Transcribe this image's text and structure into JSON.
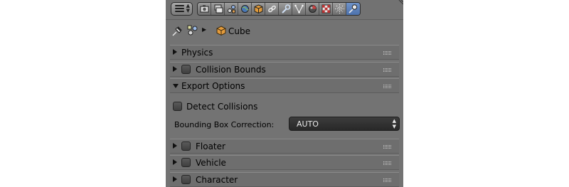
{
  "header": {
    "editor_type_icon": "properties-editor-icon",
    "tabs": [
      {
        "icon": "render-icon"
      },
      {
        "icon": "render-layers-icon"
      },
      {
        "icon": "scene-icon"
      },
      {
        "icon": "world-icon"
      },
      {
        "icon": "object-icon"
      },
      {
        "icon": "constraints-icon"
      },
      {
        "icon": "modifiers-icon"
      },
      {
        "icon": "data-icon"
      },
      {
        "icon": "material-icon"
      },
      {
        "icon": "texture-icon"
      },
      {
        "icon": "particles-icon"
      },
      {
        "icon": "physics-icon",
        "active": true
      }
    ]
  },
  "context": {
    "pin_icon": "pin-icon",
    "scene_icon": "scene-objects-icon",
    "separator_icon": "chevron-right-icon",
    "object_icon": "cube-object-icon",
    "object_name": "Cube"
  },
  "panels": {
    "physics": {
      "title": "Physics"
    },
    "collision_bounds": {
      "title": "Collision Bounds"
    },
    "export_options": {
      "title": "Export Options",
      "detect_collisions_label": "Detect Collisions",
      "bbox_label": "Bounding Box Correction:",
      "bbox_value": "AUTO"
    },
    "floater": {
      "title": "Floater"
    },
    "vehicle": {
      "title": "Vehicle"
    },
    "character": {
      "title": "Character"
    }
  },
  "colors": {
    "panel_bg": "#737373",
    "active_tab": "#5a7fbb",
    "select_bg": "#2e2e2e"
  }
}
